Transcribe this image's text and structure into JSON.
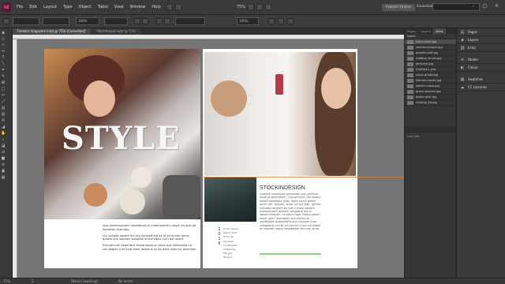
{
  "app": {
    "logo": "Id",
    "menus": [
      "File",
      "Edit",
      "Layout",
      "Type",
      "Object",
      "Table",
      "View",
      "Window",
      "Help"
    ],
    "zoom": "75%"
  },
  "header": {
    "publish": "Publish Online",
    "workspace": "Essentials",
    "search_placeholder": "",
    "window_controls": "– ▢ ✕"
  },
  "control": {
    "stroke_weight": "",
    "percent": "100%",
    "opacity": "100%"
  },
  "tabs": [
    {
      "label": "Fashion magazine.indd @ 75% [Converted]",
      "active": true
    },
    {
      "label": "*Word4word.indd @ 75%",
      "active": false
    }
  ],
  "document": {
    "title": "STYLE",
    "body": [
      "Quo omniemporem repellaturit ni moloriembre inimpe ius quis pe-dquamsu maculsa.",
      "Qui volupta eosam aut aut recesed eat ex et et facium rehen quisite quo sequam soluptae omnimilquo num aut repell.",
      "Everyancum experibus exploruptarum sequi que velecestio ius con-sequis cum quid dolor ipsamus ex ea quae volorum quaeliqui."
    ],
    "section_title": "STOCKINDESIGN",
    "section_body": "Quistem consequat doloreslam quo unintrum sandi ut quiduntiam. Quis sundent. Ulpi quatur autem voluptatur Quat.\nNobit omnis dollim quunt alit, volorias, serios ius aut fugit.\nIgnima nonsequi dolorem ea num il molor sapiem exoripidissedi istiorem voluptatur qui ut liquam hiliquam, ut eatum fugit.\nNeque adiam dolori ullam repellatum sint placest es nauditatem quaepellatis quo incipsam fuga voluptaque ius lab adi omnim ni aut aut alibea qu sequide repero voluptatem rem que pa ap.",
    "year_digits": [
      "2",
      "0",
      "1",
      "6"
    ],
    "contents": [
      "Lorem ipsum",
      "Ipsum dolor",
      "Dolor sit",
      "Sit amet",
      "Consectetur",
      "Adipiscing",
      "Elit sed",
      "Tempor"
    ]
  },
  "panels": {
    "tabs": [
      "Pages",
      "Layers",
      "Links"
    ],
    "links": [
      "Name",
      "style-cover.jpg",
      "woman-lipstick.jpg",
      "powder-puff.jpg",
      "makeup-brush.jpg",
      "perfume.jpg",
      "Untitled-1.psd",
      "cover-photo.jpg",
      "fashion-model.jpg",
      "lipstick-close.jpg",
      "green-texture.jpg",
      "bottle-pink.jpg",
      "makeup-kit.jpg"
    ],
    "link_info": "Link Info",
    "dock": [
      "Pages",
      "Layers",
      "Links",
      "Stroke",
      "Colour",
      "Swatches",
      "CC Libraries"
    ]
  },
  "status": {
    "zoom": "75%",
    "page": "2",
    "profile": "[Basic] (working)",
    "state": "No errors"
  },
  "colors": {
    "accent": "#ff4fa0",
    "guide": "#d27a3a",
    "rule": "#8fd37b"
  }
}
